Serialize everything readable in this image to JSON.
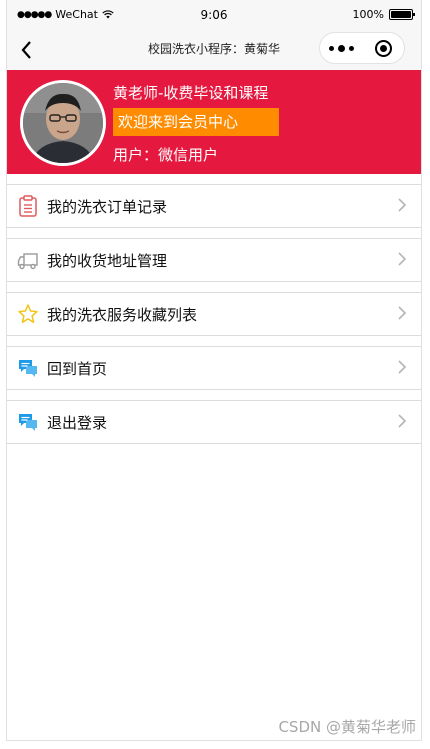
{
  "status_bar": {
    "carrier": "WeChat",
    "time": "9:06",
    "battery": "100%"
  },
  "nav": {
    "title": "校园洗衣小程序：黄菊华"
  },
  "profile": {
    "name": "黄老师-收费毕设和课程",
    "welcome": "欢迎来到会员中心",
    "user": "用户：微信用户"
  },
  "menu": {
    "items": [
      {
        "label": "我的洗衣订单记录",
        "icon": "clipboard-icon"
      },
      {
        "label": "我的收货地址管理",
        "icon": "truck-icon"
      },
      {
        "label": "我的洗衣服务收藏列表",
        "icon": "star-icon"
      },
      {
        "label": "回到首页",
        "icon": "chat-bubble-icon"
      },
      {
        "label": "退出登录",
        "icon": "chat-bubble-icon"
      }
    ]
  },
  "watermark": "CSDN @黄菊华老师",
  "colors": {
    "profile_bg": "#e5193f",
    "welcome_bg": "#ff8c00",
    "icon_blue": "#1e9be8",
    "icon_red": "#e05a5a",
    "icon_gold": "#f0c419"
  }
}
